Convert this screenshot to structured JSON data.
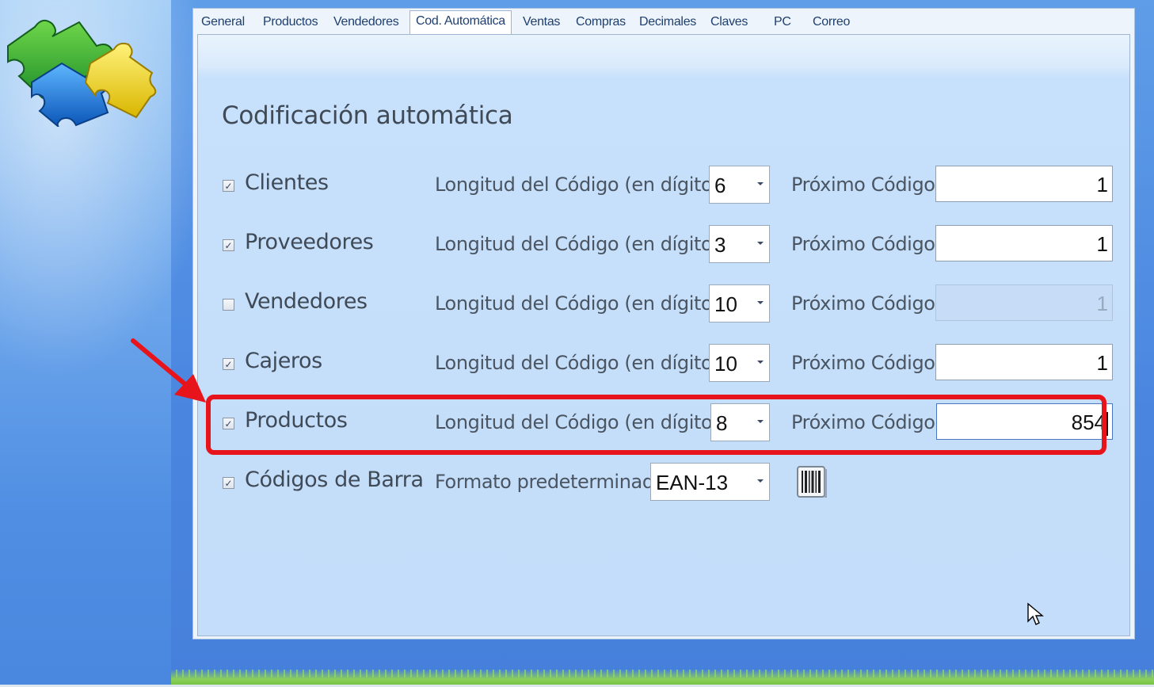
{
  "tabs": [
    {
      "label": "General",
      "active": false
    },
    {
      "label": "Productos",
      "active": false
    },
    {
      "label": "Vendedores",
      "active": false
    },
    {
      "label": "Cod. Automática",
      "active": true
    },
    {
      "label": "Ventas",
      "active": false
    },
    {
      "label": "Compras",
      "active": false
    },
    {
      "label": "Decimales",
      "active": false
    },
    {
      "label": "Claves",
      "active": false
    },
    {
      "label": "PC",
      "active": false
    },
    {
      "label": "Correo",
      "active": false
    }
  ],
  "section_title": "Codificación automática",
  "length_label": "Longitud del Código (en dígitos)",
  "next_label": "Próximo Código",
  "rows": [
    {
      "label": "Clientes",
      "checked": true,
      "length": "6",
      "next": "1",
      "enabled": true
    },
    {
      "label": "Proveedores",
      "checked": true,
      "length": "3",
      "next": "1",
      "enabled": true
    },
    {
      "label": "Vendedores",
      "checked": false,
      "length": "10",
      "next": "1",
      "enabled": false
    },
    {
      "label": "Cajeros",
      "checked": true,
      "length": "10",
      "next": "1",
      "enabled": true
    },
    {
      "label": "Productos",
      "checked": true,
      "length": "8",
      "next": "854",
      "enabled": true
    }
  ],
  "barcodes": {
    "label": "Códigos de Barra",
    "checked": true,
    "format_label": "Formato predeterminado",
    "format_value": "EAN-13"
  },
  "icons": {
    "logo": "puzzle-logo-icon",
    "barcode": "barcode-icon",
    "cursor": "mouse-cursor-icon",
    "annotation": "red-arrow-icon"
  },
  "colors": {
    "highlight": "#e8141b",
    "background": "#4a86e0",
    "panel": "#c3ddfa"
  }
}
